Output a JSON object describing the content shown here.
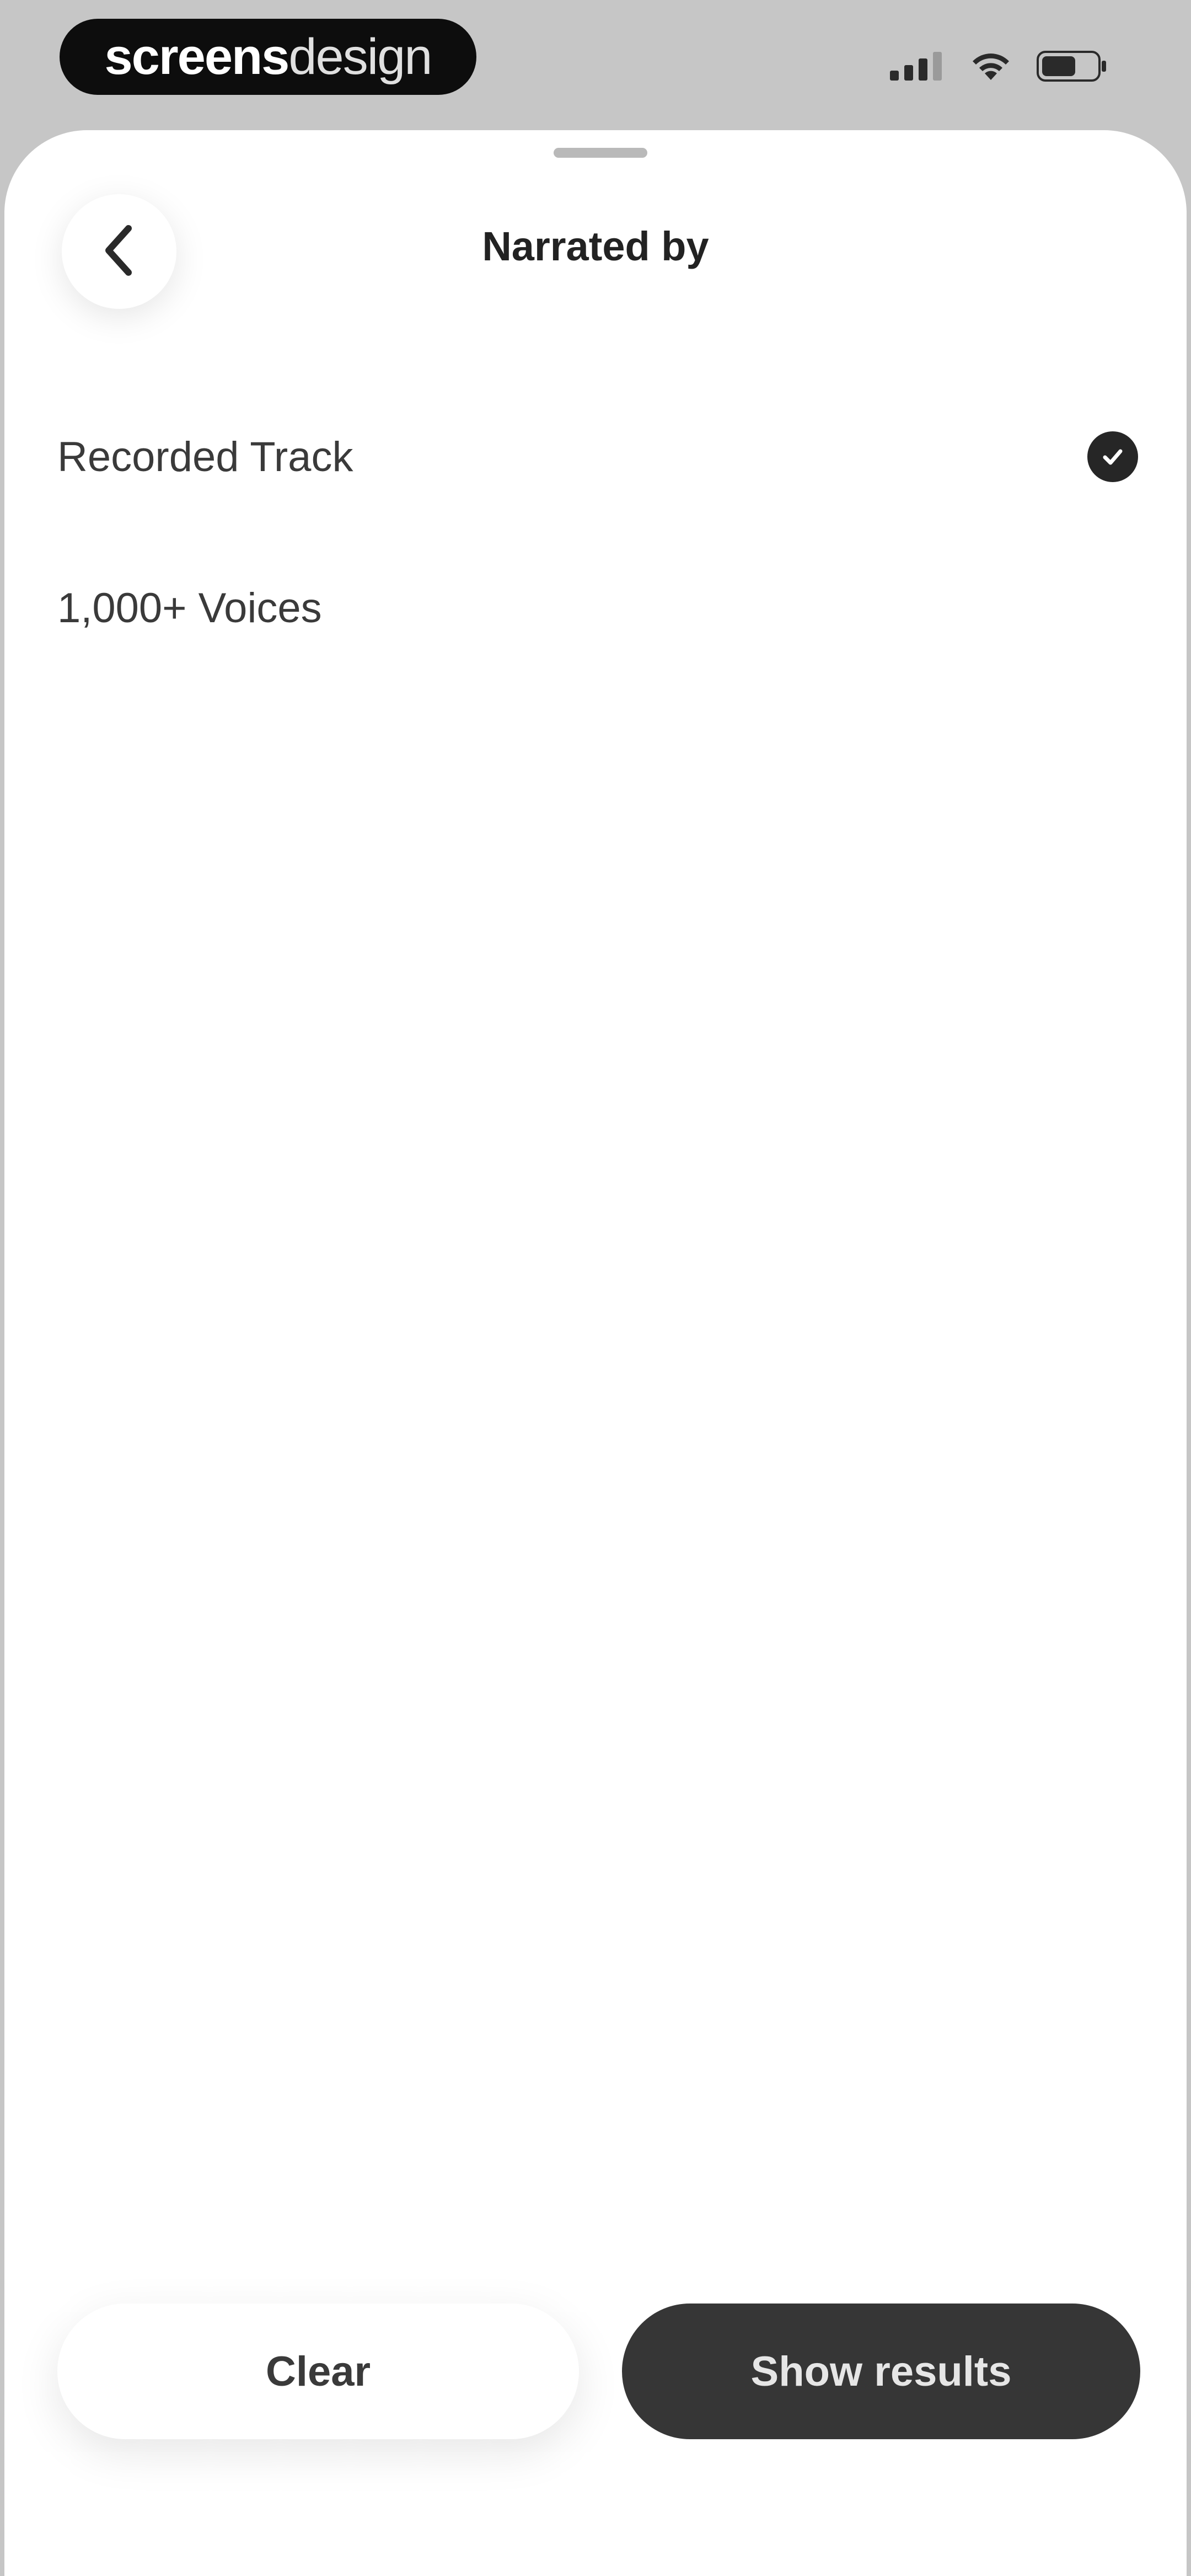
{
  "status_bar": {
    "brand_bold": "screens",
    "brand_light": "design",
    "signal_icon": "cellular-signal-icon",
    "wifi_icon": "wifi-icon",
    "battery_icon": "battery-icon"
  },
  "sheet": {
    "title": "Narrated by",
    "back_icon": "chevron-left-icon"
  },
  "options": [
    {
      "label": "Recorded Track",
      "selected": true
    },
    {
      "label": "1,000+ Voices",
      "selected": false
    }
  ],
  "footer": {
    "clear_label": "Clear",
    "show_results_label": "Show results"
  },
  "colors": {
    "primary_dark": "#363636",
    "background": "#ffffff",
    "status_bg": "#c6c6c6"
  }
}
